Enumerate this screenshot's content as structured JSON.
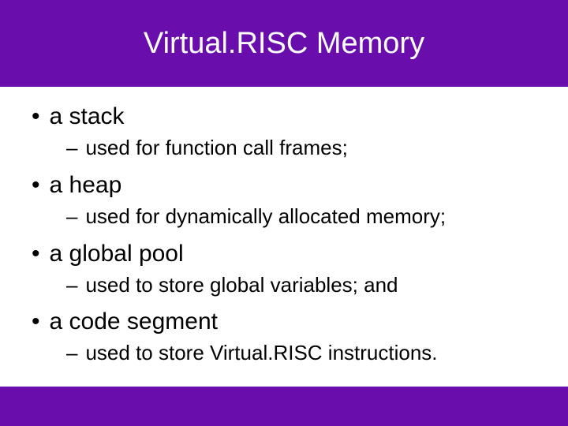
{
  "title": "Virtual.RISC Memory",
  "items": [
    {
      "label": "a stack",
      "sub": "used for function call frames;"
    },
    {
      "label": "a heap",
      "sub": "used for dynamically allocated memory;"
    },
    {
      "label": "a global pool",
      "sub": "used to store global variables; and"
    },
    {
      "label": "a code segment",
      "sub": "used to store Virtual.RISC instructions."
    }
  ],
  "glyphs": {
    "bullet": "•",
    "dash": "–"
  }
}
